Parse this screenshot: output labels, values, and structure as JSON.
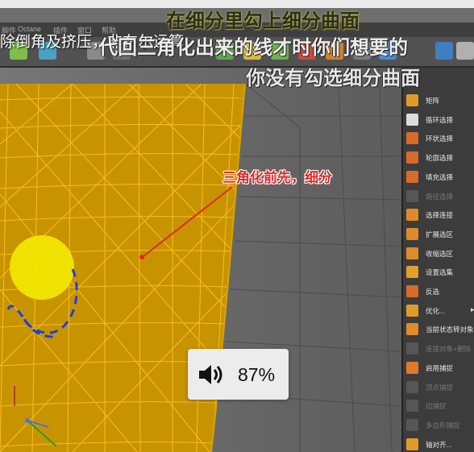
{
  "app": {
    "menu": [
      "脚件",
      "Octane",
      "插件",
      "窗口",
      "帮助"
    ]
  },
  "subtitles": {
    "line1": "在细分里勾上细分曲面",
    "line2": "除倒角及挤压，非布尔运算",
    "line3": "代回三角化出来的线才时你们想要的",
    "line4": "你没有勾选细分曲面"
  },
  "annotation": {
    "text": "三角化前先，细分",
    "color": "#e02828"
  },
  "side_menu": {
    "items": [
      {
        "label": "矩阵",
        "icon": "matrix-icon",
        "color": "#e09a2a",
        "enabled": true
      },
      {
        "label": "循环选择",
        "icon": "loop-select-icon",
        "color": "#dcdcdc",
        "enabled": true
      },
      {
        "label": "环状选择",
        "icon": "ring-select-icon",
        "color": "#d86a2a",
        "enabled": true
      },
      {
        "label": "轮廓选择",
        "icon": "outline-select-icon",
        "color": "#d86a2a",
        "enabled": true
      },
      {
        "label": "填充选择",
        "icon": "fill-select-icon",
        "color": "#d86a2a",
        "enabled": true
      },
      {
        "label": "路径选择",
        "icon": "path-select-icon",
        "color": "#888888",
        "enabled": false
      },
      {
        "label": "选择连接",
        "icon": "select-connected-icon",
        "color": "#e08a2a",
        "enabled": true
      },
      {
        "label": "扩展选区",
        "icon": "grow-selection-icon",
        "color": "#e08a2a",
        "enabled": true
      },
      {
        "label": "收缩选区",
        "icon": "shrink-selection-icon",
        "color": "#e08a2a",
        "enabled": true
      },
      {
        "label": "设置选集",
        "icon": "set-selection-icon",
        "color": "#e0a02a",
        "enabled": true
      },
      {
        "label": "反选",
        "icon": "invert-selection-icon",
        "color": "#d86a2a",
        "enabled": true
      },
      {
        "label": "优化...",
        "icon": "optimize-icon",
        "color": "#e09a2a",
        "enabled": true
      },
      {
        "label": "当前状态转对象",
        "icon": "current-state-to-object-icon",
        "color": "#e08a2a",
        "enabled": true
      },
      {
        "label": "连接对象+删除",
        "icon": "connect-objects-icon",
        "color": "#888888",
        "enabled": false
      },
      {
        "label": "启用捕捉",
        "icon": "snap-icon",
        "color": "#e07a2a",
        "enabled": true
      },
      {
        "label": "顶点捕捉",
        "icon": "vertex-snap-icon",
        "color": "#888888",
        "enabled": false
      },
      {
        "label": "边捕捉",
        "icon": "edge-snap-icon",
        "color": "#888888",
        "enabled": false
      },
      {
        "label": "多边形捕捉",
        "icon": "polygon-snap-icon",
        "color": "#888888",
        "enabled": false
      },
      {
        "label": "轴对齐...",
        "icon": "axis-align-icon",
        "color": "#e09a2a",
        "enabled": true
      }
    ]
  },
  "volume": {
    "percent_label": "87%",
    "level": 0.87,
    "icon": "speaker-icon"
  },
  "colors": {
    "mesh_fill": "#c79400",
    "wire": "#ffbe22",
    "highlight_circle": "#f2e600",
    "dash_outline": "#1f3fe0"
  }
}
